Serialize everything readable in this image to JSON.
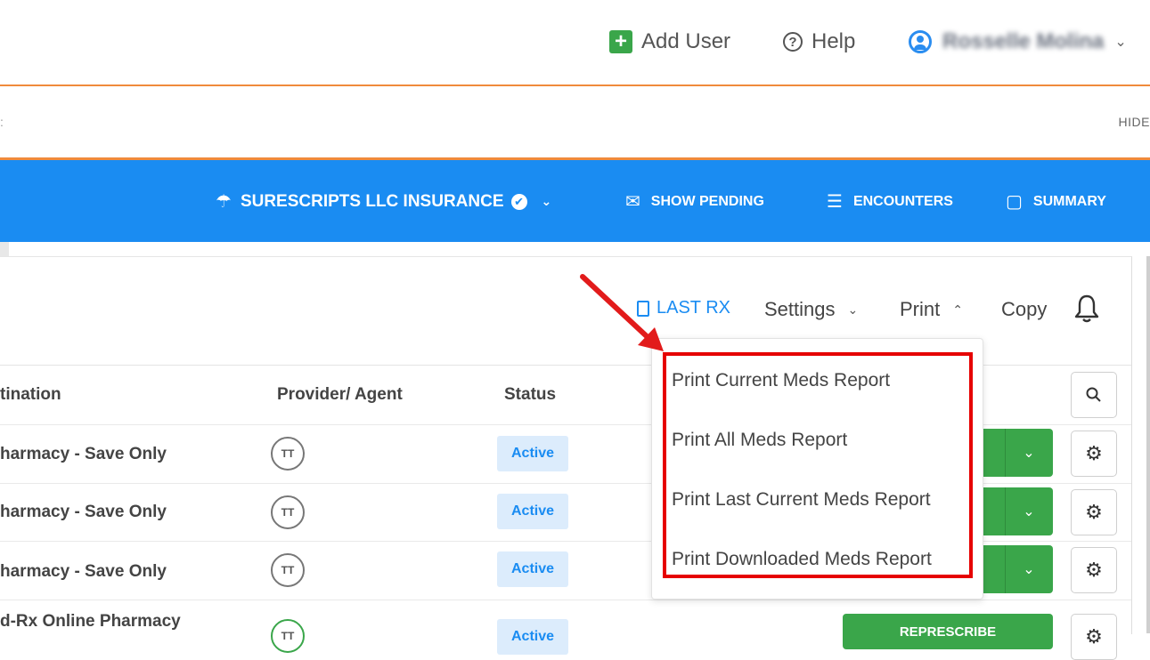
{
  "header": {
    "add_user": "Add User",
    "help": "Help",
    "user_name": "Rosselle Molina",
    "chevron": "⌄"
  },
  "banner": {
    "hide": "HIDE",
    "left_mark": ":"
  },
  "nav": {
    "insurance": "SURESCRIPTS LLC INSURANCE",
    "show_pending": "SHOW PENDING",
    "encounters": "ENCOUNTERS",
    "summary": "SUMMARY"
  },
  "toolbar": {
    "last_rx": "LAST RX",
    "settings": "Settings",
    "print": "Print",
    "copy": "Copy"
  },
  "table": {
    "headers": [
      "tination",
      "Provider/ Agent",
      "Status"
    ],
    "rows": [
      {
        "destination": "harmacy - Save Only",
        "provider": "TT",
        "status": "Active"
      },
      {
        "destination": "harmacy - Save Only",
        "provider": "TT",
        "status": "Active"
      },
      {
        "destination": "harmacy - Save Only",
        "provider": "TT",
        "status": "Active"
      },
      {
        "destination": "d-Rx Online Pharmacy",
        "provider": "TT",
        "status": "Active"
      }
    ],
    "represcribe": "REPRESCRIBE"
  },
  "print_menu": {
    "options": [
      "Print Current Meds Report",
      "Print All Meds Report",
      "Print Last Current Meds Report",
      "Print Downloaded Meds Report"
    ]
  },
  "colors": {
    "brand_blue": "#1a8cf2",
    "green": "#3aa64a",
    "orange": "#f08a3c",
    "highlight_red": "#e60000"
  }
}
